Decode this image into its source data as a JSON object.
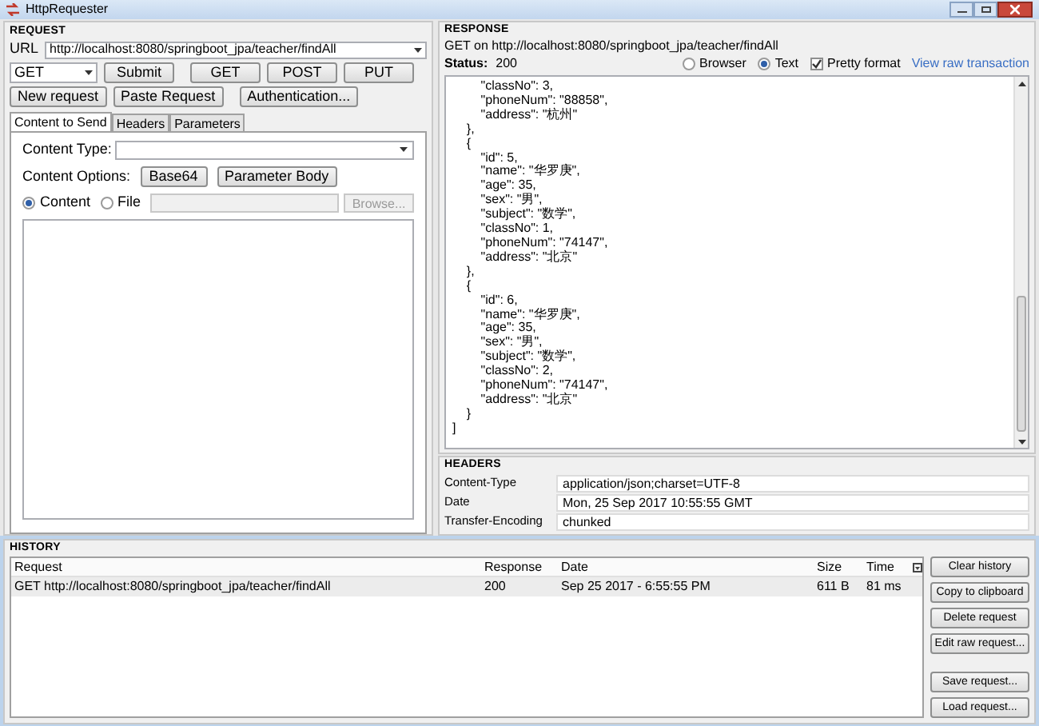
{
  "window": {
    "title": "HttpRequester"
  },
  "request": {
    "title": "REQUEST",
    "url_label": "URL",
    "url": "http://localhost:8080/springboot_jpa/teacher/findAll",
    "method": "GET",
    "buttons": [
      {
        "label": "Submit"
      },
      {
        "label": "GET"
      },
      {
        "label": "POST"
      },
      {
        "label": "PUT"
      }
    ],
    "buttons2": [
      {
        "label": "New request"
      },
      {
        "label": "Paste Request"
      },
      {
        "label": "Authentication..."
      }
    ],
    "tabs": [
      {
        "label": "Content to Send",
        "selected": true
      },
      {
        "label": "Headers",
        "selected": false
      },
      {
        "label": "Parameters",
        "selected": false
      }
    ],
    "content_type_label": "Content Type:",
    "content_options_label": "Content Options:",
    "option_buttons": [
      {
        "label": "Base64"
      },
      {
        "label": "Parameter Body"
      }
    ],
    "radios": [
      {
        "label": "Content",
        "selected": true
      },
      {
        "label": "File",
        "selected": false
      }
    ],
    "browse": {
      "label": "Browse...",
      "disabled": true
    }
  },
  "response": {
    "title": "RESPONSE",
    "summary": "GET on http://localhost:8080/springboot_jpa/teacher/findAll",
    "status_label": "Status:",
    "status": "200",
    "views": [
      {
        "label": "Browser",
        "selected": false
      },
      {
        "label": "Text",
        "selected": true
      }
    ],
    "pretty": {
      "label": "Pretty format",
      "checked": true
    },
    "raw_link": "View raw transaction",
    "lines": [
      "        \"classNo\": 3,",
      "        \"phoneNum\": \"88858\",",
      "        \"address\": \"杭州\"",
      "    },",
      "    {",
      "        \"id\": 5,",
      "        \"name\": \"华罗庚\",",
      "        \"age\": 35,",
      "        \"sex\": \"男\",",
      "        \"subject\": \"数学\",",
      "        \"classNo\": 1,",
      "        \"phoneNum\": \"74147\",",
      "        \"address\": \"北京\"",
      "    },",
      "    {",
      "        \"id\": 6,",
      "        \"name\": \"华罗庚\",",
      "        \"age\": 35,",
      "        \"sex\": \"男\",",
      "        \"subject\": \"数学\",",
      "        \"classNo\": 2,",
      "        \"phoneNum\": \"74147\",",
      "        \"address\": \"北京\"",
      "    }",
      "]"
    ]
  },
  "headers": {
    "title": "HEADERS",
    "rows": [
      {
        "name": "Content-Type",
        "value": "application/json;charset=UTF-8"
      },
      {
        "name": "Date",
        "value": "Mon, 25 Sep 2017 10:55:55 GMT"
      },
      {
        "name": "Transfer-Encoding",
        "value": "chunked"
      }
    ]
  },
  "history": {
    "title": "HISTORY",
    "columns": [
      "Request",
      "Response",
      "Date",
      "Size",
      "Time"
    ],
    "rows": [
      {
        "request": "GET http://localhost:8080/springboot_jpa/teacher/findAll",
        "response": "200",
        "date": "Sep 25 2017 - 6:55:55 PM",
        "size": "611 B",
        "time": "81 ms",
        "selected": true
      }
    ],
    "buttons": [
      {
        "label": "Clear history"
      },
      {
        "label": "Copy to clipboard"
      },
      {
        "label": "Delete request"
      },
      {
        "label": "Edit raw request..."
      },
      {
        "label": "Save request..."
      },
      {
        "label": "Load request..."
      }
    ]
  }
}
